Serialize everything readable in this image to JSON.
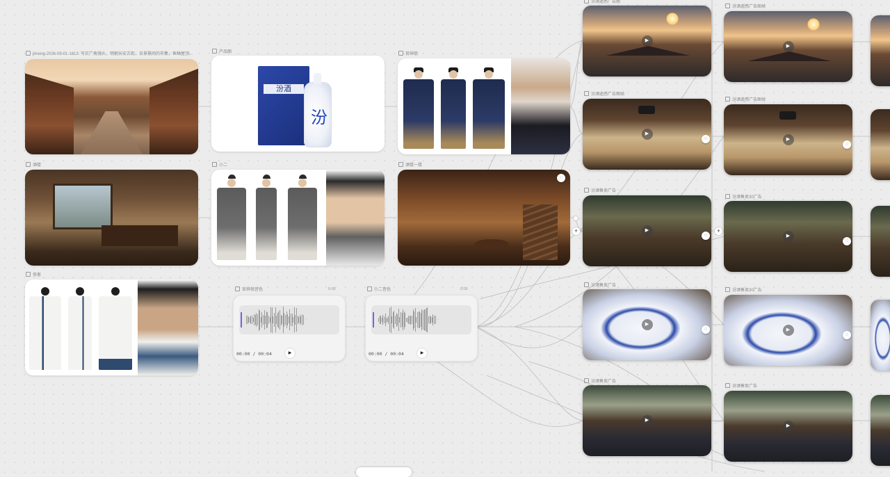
{
  "canvas": {
    "left_nodes": [
      {
        "id": "street",
        "label": "jimeng-2026-09-01-1613: 写实广角镜头，明朝长安古街，日景繁闹的市集，鱼鳞屋顶..."
      },
      {
        "id": "product",
        "label": "产品图"
      },
      {
        "id": "official",
        "label": "官绅翁"
      },
      {
        "id": "inn",
        "label": "酒楼"
      },
      {
        "id": "waiter",
        "label": "小二"
      },
      {
        "id": "hall",
        "label": "酒楼一楼"
      },
      {
        "id": "swordsman",
        "label": "侠客"
      }
    ],
    "product": {
      "box_text": "汾酒",
      "bottle_text": "汾"
    },
    "audio": [
      {
        "label": "官绅翁音色",
        "duration": "0:05",
        "time": "00:00  /  00:04"
      },
      {
        "label": "小二音色",
        "duration": "0:05",
        "time": "00:00  /  00:04"
      }
    ],
    "video_columns": [
      {
        "items": [
          {
            "label": "汾酒遥感广告图",
            "scene": "city"
          },
          {
            "label": "汾酒遥感广告图帧",
            "scene": "scroll"
          },
          {
            "label": "汾酒售卖广告",
            "scene": "tea"
          },
          {
            "label": "汾酒售卖广告",
            "scene": "bottle"
          },
          {
            "label": "汾酒售卖广告",
            "scene": "meet"
          }
        ]
      },
      {
        "items": [
          {
            "label": "汾酒遥感广告图帧",
            "scene": "city"
          },
          {
            "label": "汾酒遥感广告图帧",
            "scene": "scroll"
          },
          {
            "label": "汾酒售卖30广告",
            "scene": "tea"
          },
          {
            "label": "汾酒售卖30广告",
            "scene": "bottle"
          },
          {
            "label": "汾酒售卖广告",
            "scene": "meet"
          }
        ]
      }
    ],
    "colors": {
      "canvas_bg": "#ececec",
      "card_bg": "#ffffff",
      "wire": "#bdbdbd",
      "waveform": "#9a9a9a",
      "brand_blue": "#1f44b8"
    }
  }
}
